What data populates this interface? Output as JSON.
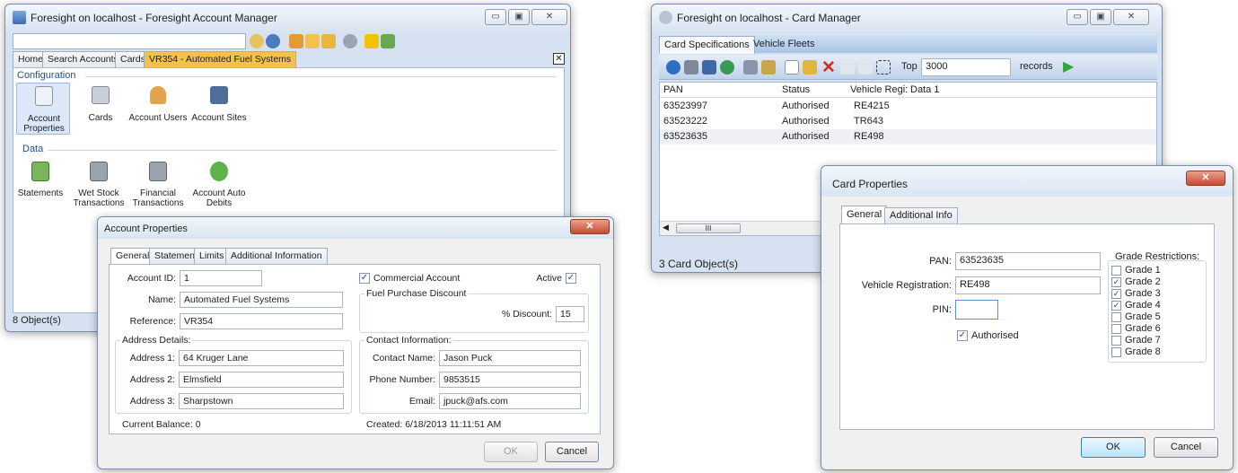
{
  "account_manager": {
    "title": "Foresight on localhost - Foresight Account Manager",
    "tabs": [
      "Home",
      "Search Accounts",
      "Cards",
      "VR354 - Automated Fuel Systems"
    ],
    "configuration": {
      "heading": "Configuration",
      "items": [
        {
          "label_line1": "Account",
          "label_line2": "Properties",
          "icon": "account-properties-icon"
        },
        {
          "label_line1": "Cards",
          "label_line2": "",
          "icon": "cards-icon"
        },
        {
          "label_line1": "Account Users",
          "label_line2": "",
          "icon": "account-users-icon"
        },
        {
          "label_line1": "Account Sites",
          "label_line2": "",
          "icon": "account-sites-icon"
        }
      ]
    },
    "data_section": {
      "heading": "Data",
      "items": [
        {
          "label_line1": "Statements",
          "label_line2": "",
          "icon": "statements-icon"
        },
        {
          "label_line1": "Wet Stock",
          "label_line2": "Transactions",
          "icon": "wet-stock-icon"
        },
        {
          "label_line1": "Financial",
          "label_line2": "Transactions",
          "icon": "financial-icon"
        },
        {
          "label_line1": "Account Auto",
          "label_line2": "Debits",
          "icon": "auto-debits-icon"
        }
      ]
    },
    "status": "8 Object(s)"
  },
  "account_properties": {
    "title": "Account Properties",
    "tabs": [
      "General",
      "Statement",
      "Limits",
      "Additional Information"
    ],
    "account_id_label": "Account ID:",
    "account_id": "1",
    "name_label": "Name:",
    "name": "Automated Fuel Systems",
    "reference_label": "Reference:",
    "reference": "VR354",
    "commercial_label": "Commercial Account",
    "commercial_checked": true,
    "active_label": "Active",
    "active_checked": true,
    "discount_group": "Fuel Purchase Discount",
    "discount_label": "% Discount:",
    "discount": "15",
    "address_group": "Address Details:",
    "address1_label": "Address 1:",
    "address1": "64 Kruger Lane",
    "address2_label": "Address 2:",
    "address2": "Elmsfield",
    "address3_label": "Address 3:",
    "address3": "Sharpstown",
    "contact_group": "Contact Information:",
    "contact_name_label": "Contact Name:",
    "contact_name": "Jason Puck",
    "phone_label": "Phone Number:",
    "phone": "9853515",
    "email_label": "Email:",
    "email": "jpuck@afs.com",
    "balance": "Current Balance: 0",
    "created": "Created:  6/18/2013 11:11:51 AM",
    "ok": "OK",
    "cancel": "Cancel"
  },
  "card_manager": {
    "title": "Foresight on localhost - Card Manager",
    "tabs": [
      "Card Specifications",
      "Vehicle Fleets"
    ],
    "top_label": "Top",
    "top_value": "3000",
    "records_label": "records",
    "columns": [
      "PAN",
      "Status",
      "Vehicle Regi:",
      "Data 1"
    ],
    "rows": [
      [
        "63523997",
        "Authorised",
        "RE4215"
      ],
      [
        "63523222",
        "Authorised",
        "TR643"
      ],
      [
        "63523635",
        "Authorised",
        "RE498"
      ]
    ],
    "scroll_grip": "III",
    "status": "3 Card Object(s)"
  },
  "card_properties": {
    "title": "Card Properties",
    "tabs": [
      "General",
      "Additional Info"
    ],
    "pan_label": "PAN:",
    "pan": "63523635",
    "vehicle_label": "Vehicle Registration:",
    "vehicle": "RE498",
    "pin_label": "PIN:",
    "pin": "",
    "authorised_label": "Authorised",
    "authorised_checked": true,
    "grade_heading": "Grade Restrictions:",
    "grades": [
      {
        "label": "Grade 1",
        "checked": false
      },
      {
        "label": "Grade 2",
        "checked": true
      },
      {
        "label": "Grade 3",
        "checked": true
      },
      {
        "label": "Grade 4",
        "checked": true
      },
      {
        "label": "Grade 5",
        "checked": false
      },
      {
        "label": "Grade 6",
        "checked": false
      },
      {
        "label": "Grade 7",
        "checked": false
      },
      {
        "label": "Grade 8",
        "checked": false
      }
    ],
    "ok": "OK",
    "cancel": "Cancel"
  }
}
